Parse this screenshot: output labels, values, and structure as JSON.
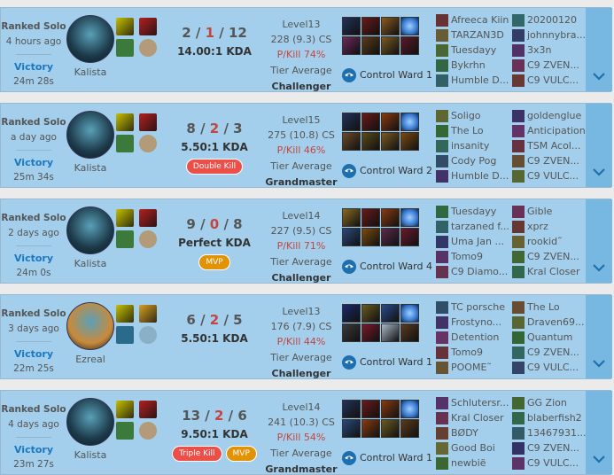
{
  "matches": [
    {
      "queue": "Ranked Solo",
      "ago": "4 hours ago",
      "result": "Victory",
      "duration": "24m 28s",
      "champion": "Kalista",
      "portrait_color": "#1c3a4a",
      "spells": [
        "#c8c000",
        "#b32020"
      ],
      "runes": [
        "#3b7a3a",
        "#b39a78"
      ],
      "kills": "2",
      "deaths": "1",
      "assists": "12",
      "slash": " / ",
      "kda": "14.00:1 KDA",
      "badges": [],
      "level": "Level13",
      "cs": "228 (9.3) CS",
      "pkill": "P/Kill 74%",
      "tier_label": "Tier Average",
      "tier": "Challenger",
      "items": [
        "#22325a",
        "#6a1a1a",
        "#8a5a20",
        "#6b2a5a",
        "#5a3a1a",
        "#7a5a20",
        "#5a1a2a"
      ],
      "trinket_color": "#3a7ad0",
      "ward_label": "Control Ward 1",
      "team1": [
        "Afreeca Kiin",
        "TARZAN3D",
        "Tuesdayy",
        "Bykrhn",
        "Humble D..."
      ],
      "team2": [
        "20200120",
        "johnnybra...",
        "3x3n",
        "C9 ZVEN...",
        "C9 VULC..."
      ]
    },
    {
      "queue": "Ranked Solo",
      "ago": "a day ago",
      "result": "Victory",
      "duration": "25m 34s",
      "champion": "Kalista",
      "portrait_color": "#1c3a4a",
      "spells": [
        "#c8c000",
        "#b32020"
      ],
      "runes": [
        "#3b7a3a",
        "#b39a78"
      ],
      "kills": "8",
      "deaths": "2",
      "assists": "3",
      "slash": " / ",
      "kda": "5.50:1 KDA",
      "badges": [
        {
          "text": "Double Kill",
          "kind": "red"
        }
      ],
      "level": "Level15",
      "cs": "275 (10.8) CS",
      "pkill": "P/Kill 46%",
      "tier_label": "Tier Average",
      "tier": "Grandmaster",
      "items": [
        "#22325a",
        "#6a1a1a",
        "#8a3a10",
        "#6b4a2a",
        "#5a4a1a",
        "#7a5a20",
        "#7a4a10"
      ],
      "trinket_color": "#3a7ad0",
      "ward_label": "Control Ward 2",
      "team1": [
        "Soligo",
        "The Lo",
        "insanity",
        "Cody Pog",
        "Humble D..."
      ],
      "team2": [
        "goldenglue",
        "Anticipation",
        "TSM Acol...",
        "C9 ZVEN...",
        "C9 VULC..."
      ]
    },
    {
      "queue": "Ranked Solo",
      "ago": "2 days ago",
      "result": "Victory",
      "duration": "24m 0s",
      "champion": "Kalista",
      "portrait_color": "#1c3a4a",
      "spells": [
        "#c8c000",
        "#b32020"
      ],
      "runes": [
        "#3b7a3a",
        "#b39a78"
      ],
      "kills": "9",
      "deaths": "0",
      "assists": "8",
      "slash": " / ",
      "kda": "Perfect KDA",
      "badges": [
        {
          "text": "MVP",
          "kind": "gold"
        }
      ],
      "level": "Level14",
      "cs": "227 (9.5) CS",
      "pkill": "P/Kill 71%",
      "tier_label": "Tier Average",
      "tier": "Challenger",
      "items": [
        "#8a6a20",
        "#6a1a1a",
        "#8a3a10",
        "#2a4a7a",
        "#7a4a10",
        "#5a2a4a",
        "#6a1a2a"
      ],
      "trinket_color": "#3a7ad0",
      "ward_label": "Control Ward 4",
      "team1": [
        "Tuesdayy",
        "tarzaned f...",
        "Uma Jan ...",
        "Tomo9",
        "C9 Diamo..."
      ],
      "team2": [
        "Gible",
        "xprz",
        "rookid˜",
        "C9 ZVEN...",
        "Kral Closer"
      ]
    },
    {
      "queue": "Ranked Solo",
      "ago": "3 days ago",
      "result": "Victory",
      "duration": "22m 25s",
      "champion": "Ezreal",
      "portrait_color": "#c98a3a",
      "spells": [
        "#c8c000",
        "#d8a020"
      ],
      "runes": [
        "#2a6a8a",
        "#8ab0c8"
      ],
      "kills": "6",
      "deaths": "2",
      "assists": "5",
      "slash": " / ",
      "kda": "5.50:1 KDA",
      "badges": [],
      "level": "Level13",
      "cs": "176 (7.9) CS",
      "pkill": "P/Kill 44%",
      "tier_label": "Tier Average",
      "tier": "Challenger",
      "items": [
        "#1a2a6a",
        "#6a5a20",
        "#2a4a8a",
        "#3a3a3a",
        "#7a1a2a",
        "#a9b7c6",
        "#5a3a20"
      ],
      "trinket_color": "#3a7ad0",
      "ward_label": "Control Ward 1",
      "team1": [
        "TC porsche",
        "Frostyno...",
        "Detention",
        "Tomo9",
        "POOME˜"
      ],
      "team2": [
        "The Lo",
        "Draven69...",
        "Quantum",
        "C9 ZVEN...",
        "C9 VULC..."
      ]
    },
    {
      "queue": "Ranked Solo",
      "ago": "4 days ago",
      "result": "Victory",
      "duration": "23m 27s",
      "champion": "Kalista",
      "portrait_color": "#1c3a4a",
      "spells": [
        "#c8c000",
        "#b32020"
      ],
      "runes": [
        "#3b7a3a",
        "#b39a78"
      ],
      "kills": "13",
      "deaths": "2",
      "assists": "6",
      "slash": " / ",
      "kda": "9.50:1 KDA",
      "badges": [
        {
          "text": "Triple Kill",
          "kind": "red"
        },
        {
          "text": "MVP",
          "kind": "gold"
        }
      ],
      "level": "Level14",
      "cs": "241 (10.3) CS",
      "pkill": "P/Kill 54%",
      "tier_label": "Tier Average",
      "tier": "Grandmaster",
      "items": [
        "#22325a",
        "#6a1a1a",
        "#8a3a10",
        "#2a4a7a",
        "#8a3a10",
        "#6a5a20",
        "#5a3a1a"
      ],
      "trinket_color": "#3a7ad0",
      "ward_label": "Control Ward 1",
      "team1": [
        "Schlutersr...",
        "Kral Closer",
        "BØDY",
        "Good Boi",
        "newbië"
      ],
      "team2": [
        "GG Zion",
        "blaberfish2",
        "13467931...",
        "C9 ZVEN...",
        "C9 VULC..."
      ]
    }
  ]
}
